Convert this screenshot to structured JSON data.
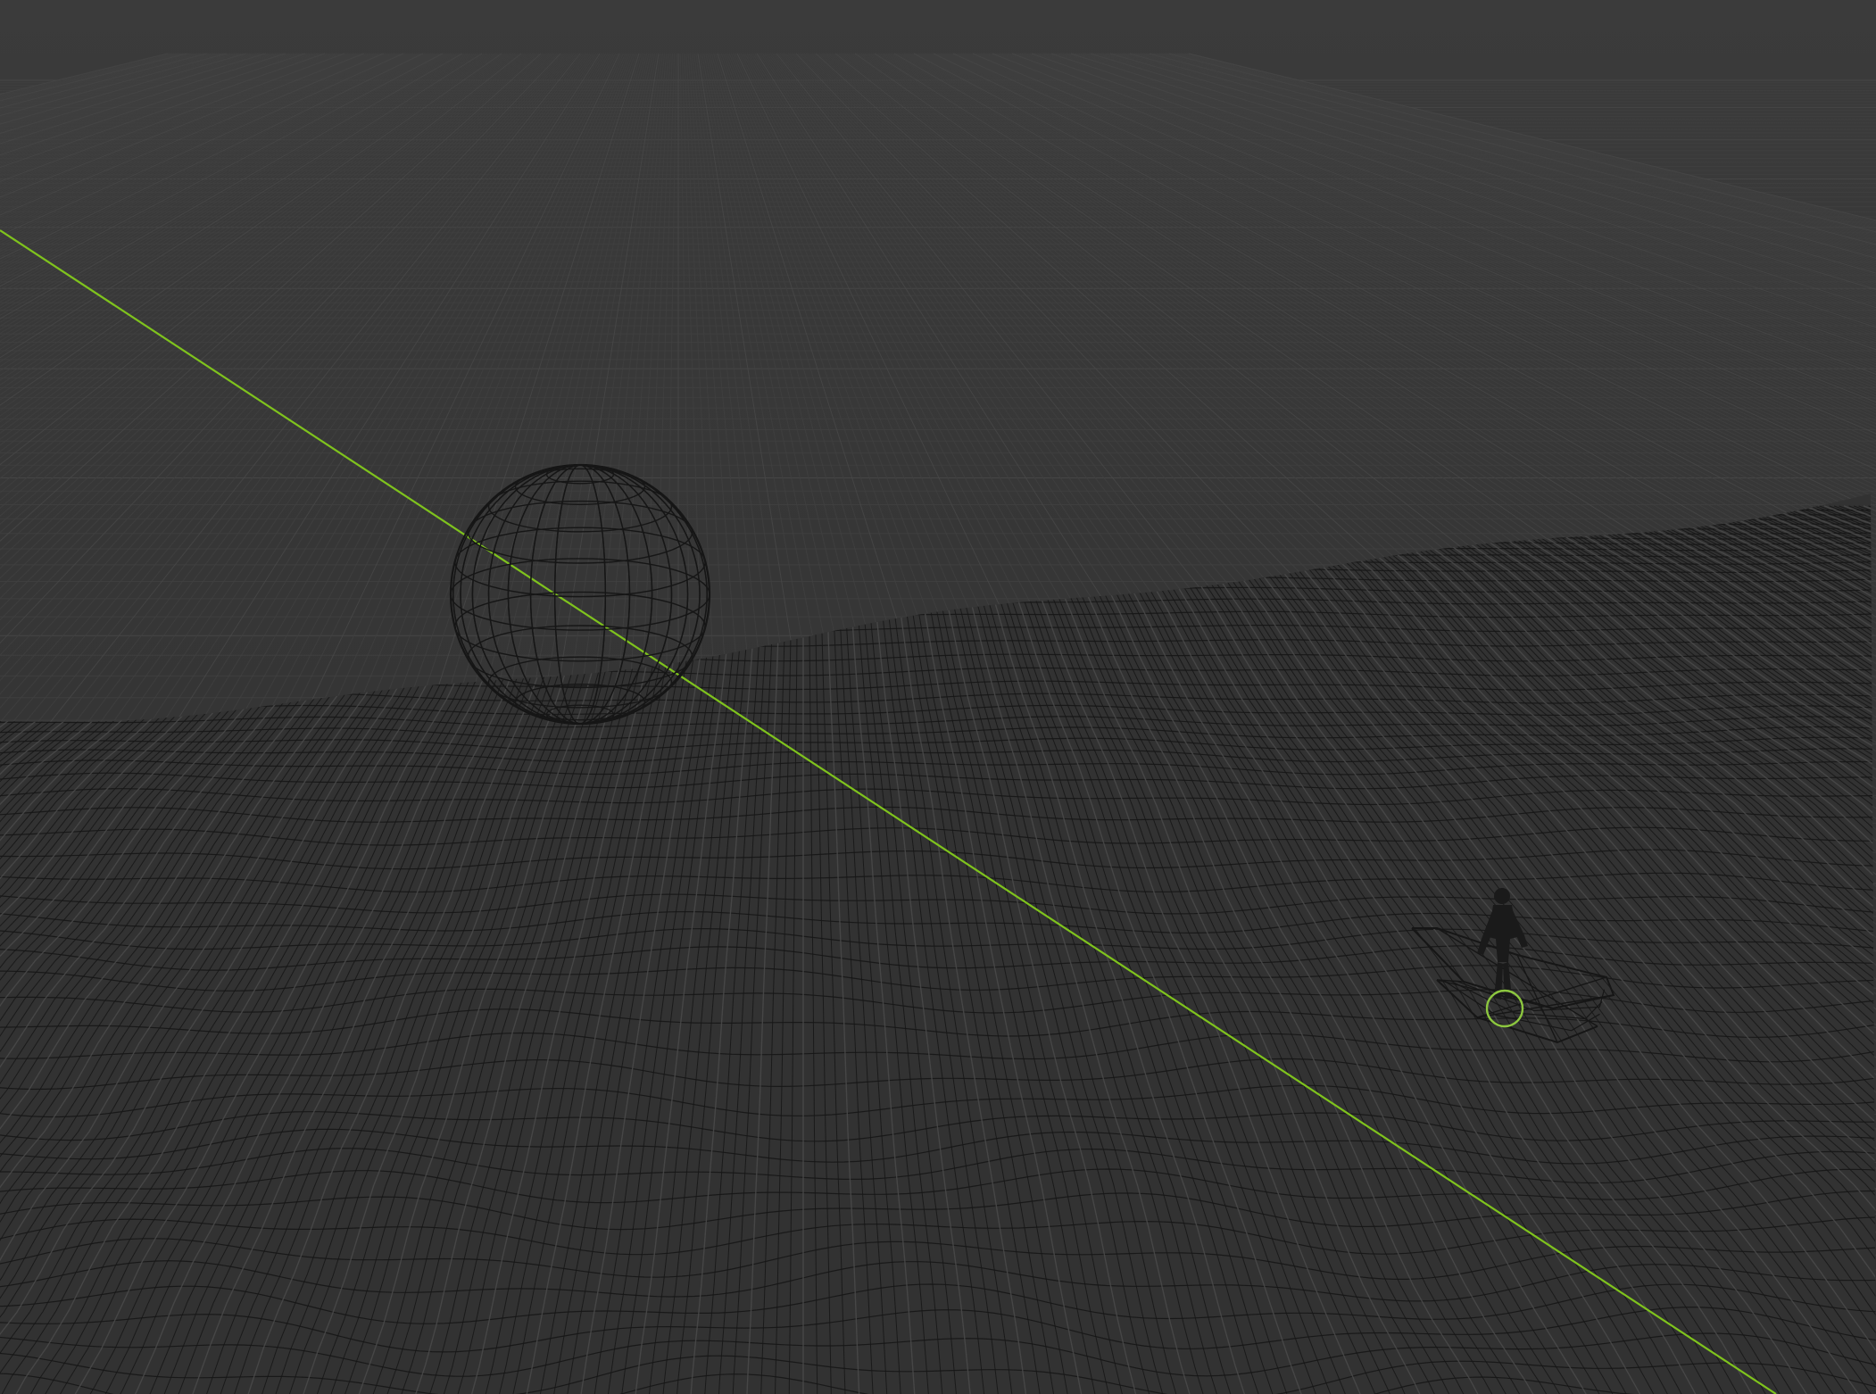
{
  "viewport": {
    "colors": {
      "background_top": "#3b3b3b",
      "background_bottom": "#2f2f2f",
      "grid_minor": "#404040",
      "grid_major": "#484848",
      "wire_dark": "#161616",
      "wire_light": "#4a4a4a",
      "y_axis": "#7fc31d",
      "origin_gizmo": "#8cc63f"
    },
    "objects": [
      {
        "name": "ocean-surface-mesh",
        "icon": "wireframe-plane"
      },
      {
        "name": "uv-sphere",
        "icon": "wireframe-sphere"
      },
      {
        "name": "rowing-boat",
        "icon": "wireframe-boat"
      },
      {
        "name": "human-figure",
        "icon": "character"
      }
    ]
  }
}
